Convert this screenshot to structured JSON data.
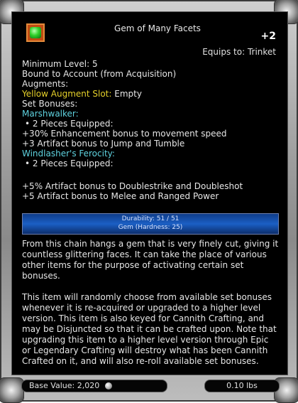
{
  "tooltip": {
    "title": "Gem of Many Facets",
    "enhancement": "+2",
    "equips_to": "Equips to: Trinket",
    "lines": [
      {
        "text": "Minimum Level: 5",
        "color": "white"
      },
      {
        "text": "Bound to Account (from Acquisition)",
        "color": "white"
      },
      {
        "text": "Augments:",
        "color": "white"
      },
      {
        "text": "Yellow Augment Slot:",
        "color": "yellow",
        "suffix": "Empty"
      },
      {
        "text": "Set Bonuses:",
        "color": "white"
      },
      {
        "text": "Marshwalker:",
        "color": "cyan"
      },
      {
        "text": "• 2 Pieces Equipped:",
        "color": "white"
      },
      {
        "text": "+30% Enhancement bonus to movement speed",
        "color": "white"
      },
      {
        "text": "+3 Artifact bonus to Jump and Tumble",
        "color": "white"
      },
      {
        "text": "Windlasher's Ferocity:",
        "color": "cyan"
      },
      {
        "text": "• 2 Pieces Equipped:",
        "color": "white"
      },
      {
        "text": "+5% Artifact bonus to Doublestrike and Doubleshot",
        "color": "white"
      },
      {
        "text": "+5 Artifact bonus to Melee and Ranged Power",
        "color": "white"
      }
    ],
    "durability": "Durability: 51 / 51",
    "gem_hardness": "Gem (Hardness: 25)",
    "description": [
      "From this chain hangs a gem that is very finely cut, giving it countless glittering faces. It can take the place of various other items for the purpose of activating certain set bonuses.",
      "This item will randomly choose from available set bonuses whenever it is re-acquired or upgraded to a higher level version. This item is also keyed for Cannith Crafting, and may be Disjuncted so that it can be crafted upon. Note that upgrading this item to a higher level version through Epic or Legendary Crafting will destroy what has been Cannith Crafted on it, and will also re-roll available set bonuses."
    ],
    "base_value_label": "Base Value:",
    "base_value": "2,020",
    "weight": "0.10 lbs",
    "icon_name": "green-gem-icon",
    "coin_icon": "coin-icon",
    "colors": {
      "white": "#e6e6e6",
      "yellow": "#e6d12a",
      "cyan": "#5fd3e0",
      "durability_bar": "#1b5fc4",
      "icon_bg": "#c14a12"
    }
  }
}
